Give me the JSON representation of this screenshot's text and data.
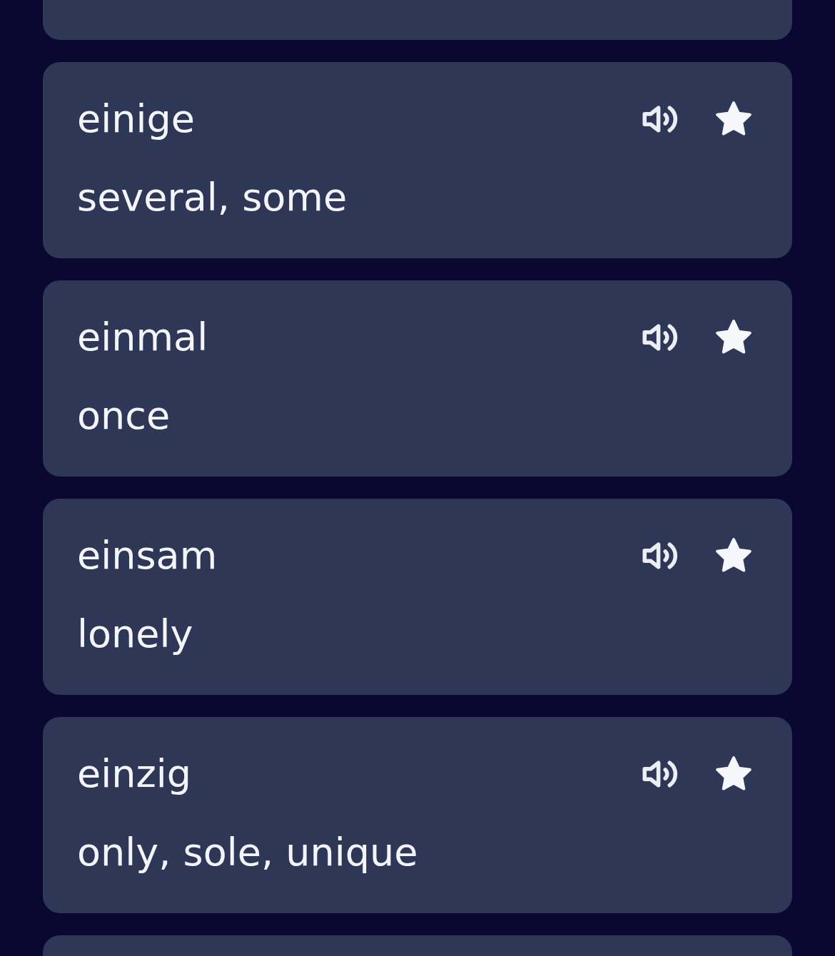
{
  "words": [
    {
      "word": "einige",
      "translation": "several, some",
      "starred": true
    },
    {
      "word": "einmal",
      "translation": "once",
      "starred": true
    },
    {
      "word": "einsam",
      "translation": "lonely",
      "starred": true
    },
    {
      "word": "einzig",
      "translation": "only, sole, unique",
      "starred": true
    }
  ]
}
